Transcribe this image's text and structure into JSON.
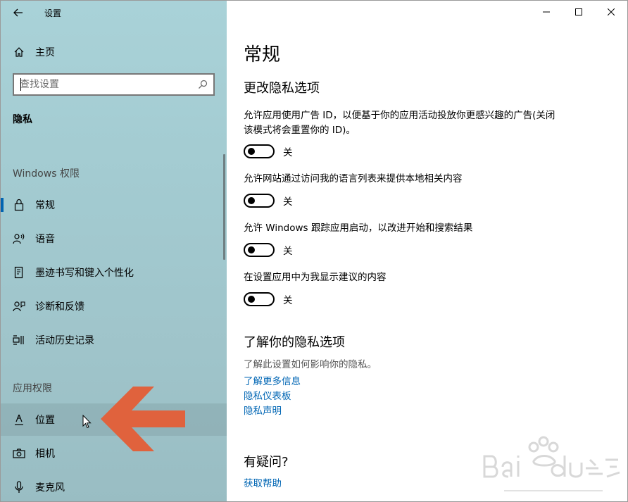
{
  "window": {
    "title": "设置",
    "controls": {
      "minimize": "minimize",
      "maximize": "maximize",
      "close": "close"
    }
  },
  "sidebar": {
    "home_label": "主页",
    "search_placeholder": "查找设置",
    "section_title": "隐私",
    "windows_perms_label": "Windows 权限",
    "windows_items": [
      {
        "label": "常规",
        "icon": "lock-icon",
        "selected": true
      },
      {
        "label": "语音",
        "icon": "speech-icon"
      },
      {
        "label": "墨迹书写和键入个性化",
        "icon": "inking-icon"
      },
      {
        "label": "诊断和反馈",
        "icon": "feedback-icon"
      },
      {
        "label": "活动历史记录",
        "icon": "history-icon"
      }
    ],
    "app_perms_label": "应用权限",
    "app_items": [
      {
        "label": "位置",
        "icon": "location-icon",
        "hovered": true
      },
      {
        "label": "相机",
        "icon": "camera-icon"
      },
      {
        "label": "麦克风",
        "icon": "microphone-icon"
      }
    ]
  },
  "content": {
    "title": "常规",
    "privacy_heading": "更改隐私选项",
    "options": [
      {
        "text": "允许应用使用广告 ID，以便基于你的应用活动投放你更感兴趣的广告(关闭该模式将会重置你的 ID)。",
        "state": "关"
      },
      {
        "text": "允许网站通过访问我的语言列表来提供本地相关内容",
        "state": "关"
      },
      {
        "text": "允许 Windows 跟踪应用启动，以改进开始和搜索结果",
        "state": "关"
      },
      {
        "text": "在设置应用中为我显示建议的内容",
        "state": "关"
      }
    ],
    "learn_heading": "了解你的隐私选项",
    "learn_desc": "了解此设置如何影响你的隐私。",
    "links": [
      "了解更多信息",
      "隐私仪表板",
      "隐私声明"
    ],
    "question_heading": "有疑问?",
    "help_link": "获取帮助"
  },
  "colors": {
    "accent": "#0063b1",
    "link": "#0066b4",
    "annotation_arrow": "#e0623d"
  }
}
